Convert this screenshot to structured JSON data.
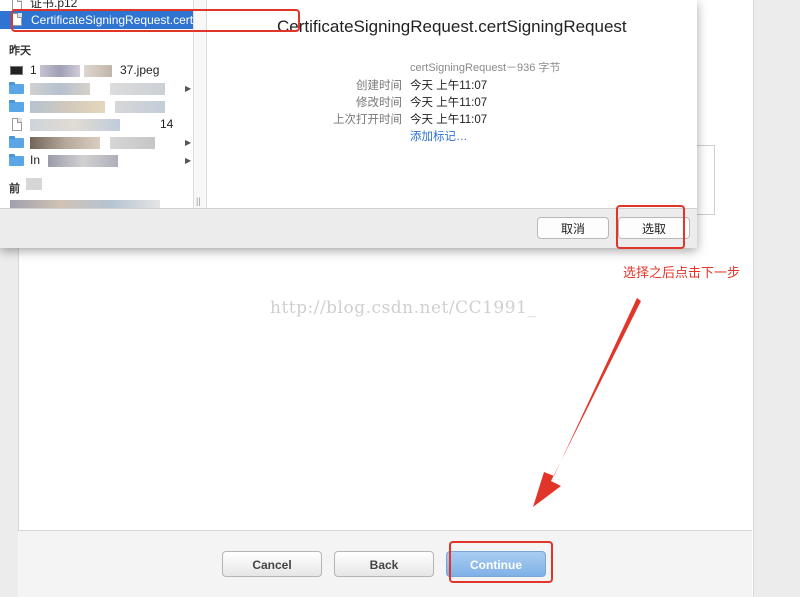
{
  "dialog": {
    "selected_file": "CertificateSigningRequest.certSigningRequest",
    "top_partial_file": "证书.p12",
    "section_yesterday": "昨天",
    "section_before": "前",
    "file_rows": [
      {
        "name": "1",
        "suffix": "37.jpeg",
        "type": "image"
      },
      {
        "name": "",
        "suffix": "",
        "type": "folder",
        "expandable": true
      },
      {
        "name": "",
        "suffix": "",
        "type": "folder"
      },
      {
        "name": "",
        "suffix": "14",
        "type": "document"
      },
      {
        "name": "",
        "suffix": "",
        "type": "folder",
        "expandable": true
      },
      {
        "name": "In",
        "suffix": "",
        "type": "folder",
        "expandable": true
      }
    ],
    "preview": {
      "title": "CertificateSigningRequest.certSigningRequest",
      "kind_size": "certSigningRequest－936 字节",
      "created_label": "创建时间",
      "created_value": "今天 上午11:07",
      "modified_label": "修改时间",
      "modified_value": "今天 上午11:07",
      "opened_label": "上次打开时间",
      "opened_value": "今天 上午11:07",
      "add_tags": "添加标记…"
    },
    "cancel_label": "取消",
    "choose_label": "选取"
  },
  "page": {
    "watermark": "http://blog.csdn.net/CC1991_",
    "cancel_label": "Cancel",
    "back_label": "Back",
    "continue_label": "Continue"
  },
  "annotation": {
    "text": "选择之后点击下一步",
    "color": "#e2352a"
  },
  "colors": {
    "selection": "#2f74d0",
    "primary_button": "#7fb1e6",
    "highlight": "#e2352a"
  }
}
